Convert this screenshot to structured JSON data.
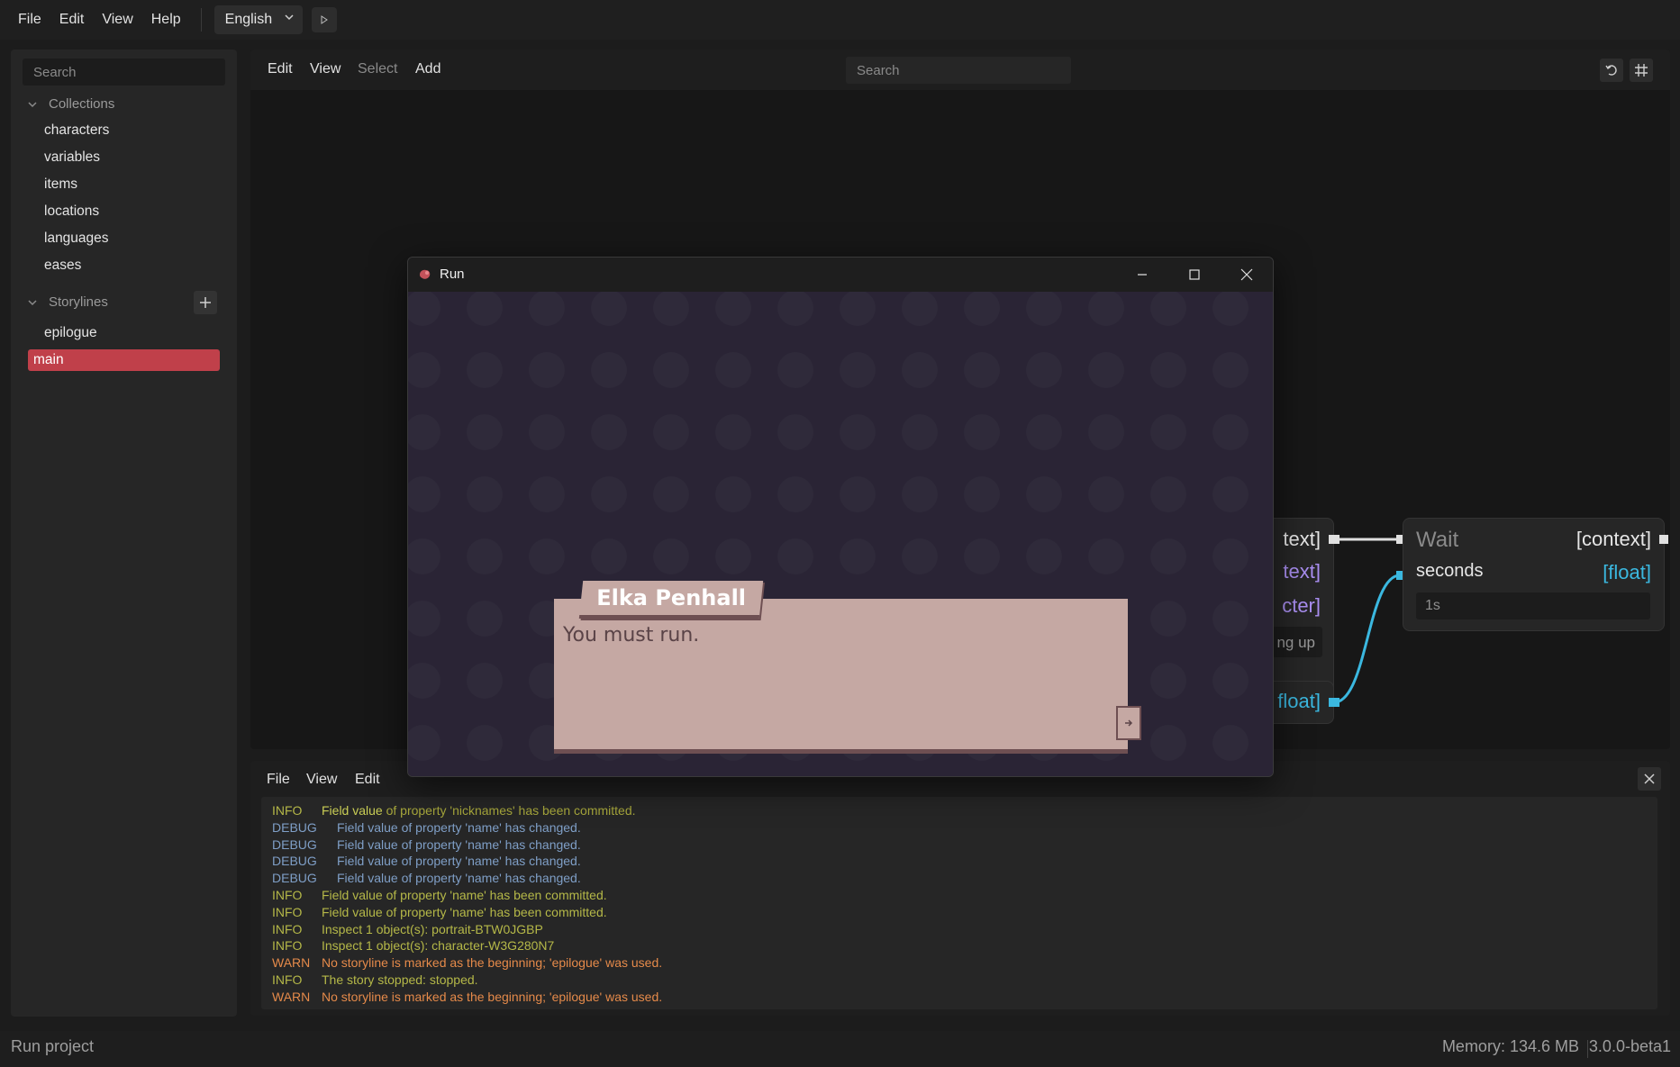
{
  "menubar": {
    "items": [
      "File",
      "Edit",
      "View",
      "Help"
    ],
    "language": "English"
  },
  "sidebar": {
    "search_placeholder": "Search",
    "collections_label": "Collections",
    "collections": [
      "characters",
      "variables",
      "items",
      "locations",
      "languages",
      "eases"
    ],
    "storylines_label": "Storylines",
    "storylines": [
      "epilogue",
      "main"
    ],
    "selected_storyline": "main"
  },
  "editor": {
    "menu": [
      "Edit",
      "View",
      "Select",
      "Add"
    ],
    "search_placeholder": "Search",
    "graph": {
      "left_node_ports": [
        "text]",
        "text]",
        "cter]",
        "ng up",
        "float]"
      ],
      "wait_node": {
        "title": "Wait",
        "output_type": "[context]",
        "input_label": "seconds",
        "input_type": "[float]",
        "input_value": "1s"
      }
    }
  },
  "console": {
    "menu": [
      "File",
      "View",
      "Edit"
    ],
    "lines": [
      {
        "level": "INFO",
        "msg_hl": "Field value",
        "msg": " of property 'nicknames' has been committed."
      },
      {
        "level": "DEBUG",
        "msg_hl": "",
        "msg": "Field value of property 'name' has changed."
      },
      {
        "level": "DEBUG",
        "msg_hl": "",
        "msg": "Field value of property 'name' has changed."
      },
      {
        "level": "DEBUG",
        "msg_hl": "",
        "msg": "Field value of property 'name' has changed."
      },
      {
        "level": "DEBUG",
        "msg_hl": "",
        "msg": "Field value of property 'name' has changed."
      },
      {
        "level": "INFO",
        "msg_hl": "",
        "msg": "Field value of property 'name' has been committed."
      },
      {
        "level": "INFO",
        "msg_hl": "",
        "msg": "Field value of property 'name' has been committed."
      },
      {
        "level": "INFO",
        "msg_hl": "",
        "msg": "Inspect 1 object(s): portrait-BTW0JGBP"
      },
      {
        "level": "INFO",
        "msg_hl": "",
        "msg": "Inspect 1 object(s): character-W3G280N7"
      },
      {
        "level": "WARN",
        "msg_hl": "",
        "msg": "No storyline is marked as the beginning; 'epilogue' was used."
      },
      {
        "level": "INFO",
        "msg_hl": "",
        "msg": "The story stopped: stopped."
      },
      {
        "level": "WARN",
        "msg_hl": "",
        "msg": "No storyline is marked as the beginning; 'epilogue' was used."
      }
    ]
  },
  "statusbar": {
    "left": "Run project",
    "memory": "Memory: 134.6 MB",
    "version": "3.0.0-beta1"
  },
  "run_window": {
    "title": "Run",
    "speaker": "Elka Penhall",
    "dialogue": "You must run."
  },
  "colors": {
    "accent_selected": "#c0404a",
    "wire_blue": "#3bb8e0",
    "port_purple": "#a98ef0",
    "dialogue_box": "#c5a8a3",
    "stage_bg": "#2a2435"
  }
}
